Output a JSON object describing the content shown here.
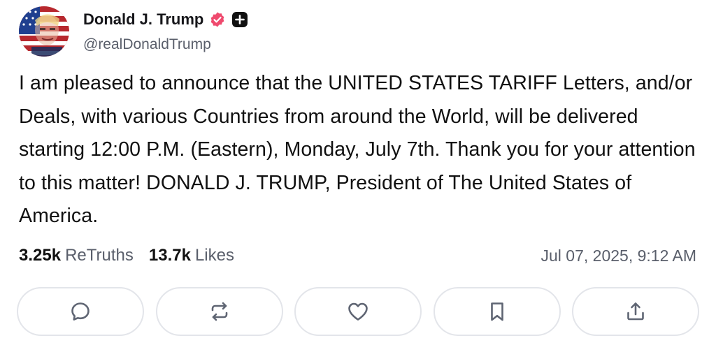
{
  "author": {
    "display_name": "Donald J. Trump",
    "handle": "@realDonaldTrump",
    "avatar_icon": "flag-portrait-avatar",
    "verified_icon": "verified-badge-icon",
    "plus_icon": "plus-badge-icon"
  },
  "post": {
    "text": "I am pleased to announce that the UNITED STATES TARIFF Letters, and/or Deals, with various Countries from around the World, will be delivered starting 12:00 P.M. (Eastern), Monday, July 7th. Thank you for your attention to this matter! DONALD J. TRUMP, President of The United States of America.",
    "timestamp": "Jul 07, 2025, 9:12 AM"
  },
  "stats": {
    "retruths_count": "3.25k",
    "retruths_label": "ReTruths",
    "likes_count": "13.7k",
    "likes_label": "Likes"
  },
  "actions": [
    {
      "name": "reply",
      "icon": "reply-bubble-icon"
    },
    {
      "name": "retruth",
      "icon": "retruth-arrows-icon"
    },
    {
      "name": "like",
      "icon": "heart-icon"
    },
    {
      "name": "bookmark",
      "icon": "bookmark-icon"
    },
    {
      "name": "share",
      "icon": "share-upload-icon"
    }
  ],
  "colors": {
    "verified_badge": "#ef4a6e",
    "text_primary": "#111111",
    "text_secondary": "#5a5f6b",
    "button_border": "#e3e5ea",
    "icon_stroke": "#5f6573"
  }
}
